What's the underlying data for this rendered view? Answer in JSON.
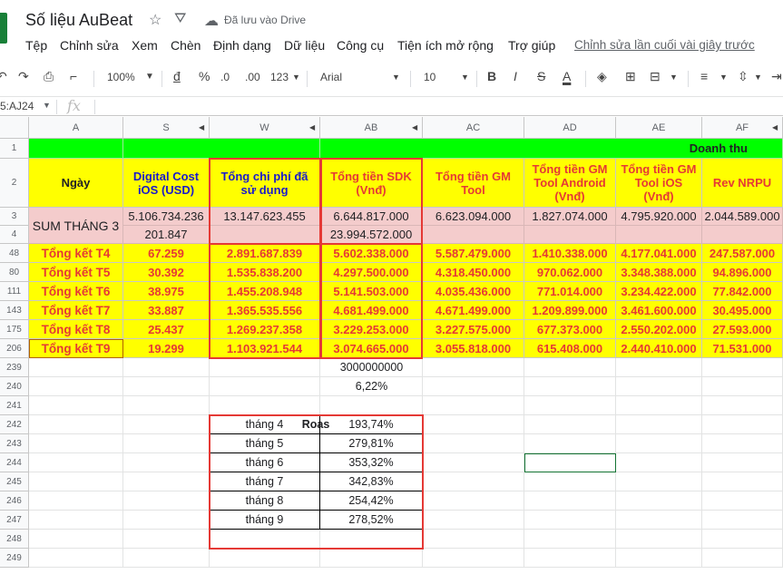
{
  "app": {
    "title": "Số liệu AuBeat",
    "saved_status": "Đã lưu vào Drive",
    "last_edit": "Chỉnh sửa lần cuối vài giây trước"
  },
  "menu": [
    "Tệp",
    "Chỉnh sửa",
    "Xem",
    "Chèn",
    "Định dạng",
    "Dữ liệu",
    "Công cụ",
    "Tiện ích mở rộng",
    "Trợ giúp"
  ],
  "toolbar": {
    "zoom": "100%",
    "currency": "đ",
    "percent": "%",
    "dec_less": ".0",
    "dec_more": ".00",
    "format": "123",
    "font": "Arial",
    "font_size": "10"
  },
  "formula_bar": {
    "name_box": "5:AJ24",
    "fx": "fx",
    "value": ""
  },
  "columns": [
    "A",
    "S",
    "W",
    "AB",
    "AC",
    "AD",
    "AE",
    "AF"
  ],
  "rows": [
    "1",
    "2",
    "3",
    "4",
    "48",
    "80",
    "111",
    "143",
    "175",
    "206",
    "239",
    "240",
    "241",
    "242",
    "243",
    "244",
    "245",
    "246",
    "247",
    "248",
    "249"
  ],
  "header": {
    "doanh_thu": "Doanh thu",
    "ngay": "Ngày",
    "digital_cost": "Digital Cost iOS (USD)",
    "tong_chi_phi": "Tổng chi phí đã sử dụng",
    "tong_tien_sdk": "Tổng tiền SDK (Vnđ)",
    "tong_tien_gm": "Tổng tiền GM Tool",
    "gm_android": "Tổng tiền GM Tool Android (Vnđ)",
    "gm_ios": "Tổng tiền GM Tool iOS (Vnđ)",
    "rev_nrpu": "Rev NRPU"
  },
  "sum": {
    "label": "SUM THÁNG 3",
    "s3": "5.106.734.236",
    "w3": "13.147.623.455",
    "ab3": "6.644.817.000",
    "ac3": "6.623.094.000",
    "ad3": "1.827.074.000",
    "ae3": "4.795.920.000",
    "af3": "2.044.589.000",
    "s4": "201.847",
    "ab4": "23.994.572.000"
  },
  "summary_rows": [
    {
      "label": "Tổng kết T4",
      "s": "67.259",
      "w": "2.891.687.839",
      "ab": "5.602.338.000",
      "ac": "5.587.479.000",
      "ad": "1.410.338.000",
      "ae": "4.177.041.000",
      "af": "247.587.000"
    },
    {
      "label": "Tổng kết T5",
      "s": "30.392",
      "w": "1.535.838.200",
      "ab": "4.297.500.000",
      "ac": "4.318.450.000",
      "ad": "970.062.000",
      "ae": "3.348.388.000",
      "af": "94.896.000"
    },
    {
      "label": "Tổng kết T6",
      "s": "38.975",
      "w": "1.455.208.948",
      "ab": "5.141.503.000",
      "ac": "4.035.436.000",
      "ad": "771.014.000",
      "ae": "3.234.422.000",
      "af": "77.842.000"
    },
    {
      "label": "Tổng kết T7",
      "s": "33.887",
      "w": "1.365.535.556",
      "ab": "4.681.499.000",
      "ac": "4.671.499.000",
      "ad": "1.209.899.000",
      "ae": "3.461.600.000",
      "af": "30.495.000"
    },
    {
      "label": "Tổng kết T8",
      "s": "25.437",
      "w": "1.269.237.358",
      "ab": "3.229.253.000",
      "ac": "3.227.575.000",
      "ad": "677.373.000",
      "ae": "2.550.202.000",
      "af": "27.593.000"
    },
    {
      "label": "Tổng kết T9",
      "s": "19.299",
      "w": "1.103.921.544",
      "ab": "3.074.665.000",
      "ac": "3.055.818.000",
      "ad": "615.408.000",
      "ae": "2.440.410.000",
      "af": "71.531.000"
    }
  ],
  "extra": {
    "ab239": "3000000000",
    "ab240": "6,22%"
  },
  "roas": {
    "title": "Roas",
    "rows": [
      {
        "m": "tháng 4",
        "v": "193,74%"
      },
      {
        "m": "tháng 5",
        "v": "279,81%"
      },
      {
        "m": "tháng 6",
        "v": "353,32%"
      },
      {
        "m": "tháng 7",
        "v": "342,83%"
      },
      {
        "m": "tháng 8",
        "v": "254,42%"
      },
      {
        "m": "tháng 9",
        "v": "278,52%"
      }
    ]
  }
}
